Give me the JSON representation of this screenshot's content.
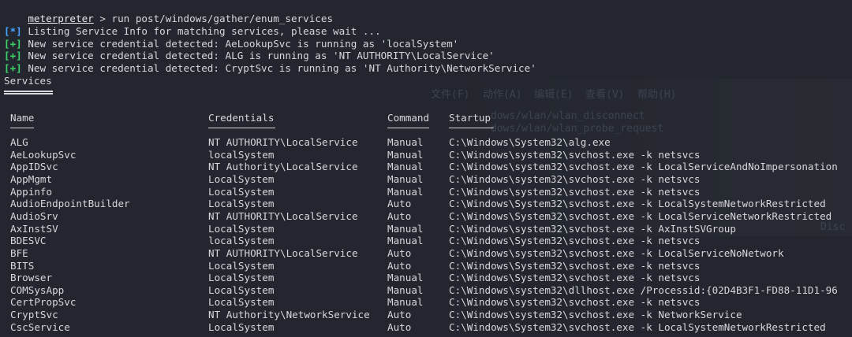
{
  "prompt": {
    "name": "meterpreter",
    "command": " > run post/windows/gather/enum_services"
  },
  "messages": [
    {
      "tag": "[*]",
      "kind": "info",
      "text": " Listing Service Info for matching services, please wait ..."
    },
    {
      "tag": "[+]",
      "kind": "good",
      "text": " New service credential detected: AeLookupSvc is running as 'localSystem'"
    },
    {
      "tag": "[+]",
      "kind": "good",
      "text": " New service credential detected: ALG is running as 'NT AUTHORITY\\LocalService'"
    },
    {
      "tag": "[+]",
      "kind": "good",
      "text": " New service credential detected: CryptSvc is running as 'NT Authority\\NetworkService'"
    }
  ],
  "section_title": "Services",
  "table": {
    "headers": [
      "Name",
      "Credentials",
      "Command",
      "Startup"
    ],
    "rows": [
      [
        "ALG",
        "NT AUTHORITY\\LocalService",
        "Manual",
        "C:\\Windows\\System32\\alg.exe"
      ],
      [
        "AeLookupSvc",
        "localSystem",
        "Manual",
        "C:\\Windows\\system32\\svchost.exe -k netsvcs"
      ],
      [
        "AppIDSvc",
        "NT Authority\\LocalService",
        "Manual",
        "C:\\Windows\\system32\\svchost.exe -k LocalServiceAndNoImpersonation"
      ],
      [
        "AppMgmt",
        "LocalSystem",
        "Manual",
        "C:\\Windows\\system32\\svchost.exe -k netsvcs"
      ],
      [
        "Appinfo",
        "LocalSystem",
        "Manual",
        "C:\\Windows\\system32\\svchost.exe -k netsvcs"
      ],
      [
        "AudioEndpointBuilder",
        "LocalSystem",
        "Auto",
        "C:\\Windows\\System32\\svchost.exe -k LocalSystemNetworkRestricted"
      ],
      [
        "AudioSrv",
        "NT AUTHORITY\\LocalService",
        "Auto",
        "C:\\Windows\\System32\\svchost.exe -k LocalServiceNetworkRestricted"
      ],
      [
        "AxInstSV",
        "LocalSystem",
        "Manual",
        "C:\\Windows\\system32\\svchost.exe -k AxInstSVGroup"
      ],
      [
        "BDESVC",
        "localSystem",
        "Manual",
        "C:\\Windows\\System32\\svchost.exe -k netsvcs"
      ],
      [
        "BFE",
        "NT AUTHORITY\\LocalService",
        "Auto",
        "C:\\Windows\\system32\\svchost.exe -k LocalServiceNoNetwork"
      ],
      [
        "BITS",
        "LocalSystem",
        "Auto",
        "C:\\Windows\\System32\\svchost.exe -k netsvcs"
      ],
      [
        "Browser",
        "LocalSystem",
        "Manual",
        "C:\\Windows\\System32\\svchost.exe -k netsvcs"
      ],
      [
        "COMSysApp",
        "LocalSystem",
        "Manual",
        "C:\\Windows\\system32\\dllhost.exe /Processid:{02D4B3F1-FD88-11D1-96"
      ],
      [
        "CertPropSvc",
        "LocalSystem",
        "Manual",
        "C:\\Windows\\system32\\svchost.exe -k netsvcs"
      ],
      [
        "CryptSvc",
        "NT Authority\\NetworkService",
        "Auto",
        "C:\\Windows\\system32\\svchost.exe -k NetworkService"
      ],
      [
        "CscService",
        "LocalSystem",
        "Auto",
        "C:\\Windows\\System32\\svchost.exe -k LocalSystemNetworkRestricted"
      ]
    ]
  },
  "background_ghost": {
    "menu": [
      "文件(F)",
      "动作(A)",
      "编辑(E)",
      "查看(V)",
      "帮助(H)"
    ],
    "lines": [
      "dows/wlan/wlan_disconnect",
      "dows/wlan/wlan_probe_request",
      "Disc"
    ]
  },
  "colors": {
    "background": "#23262e",
    "text": "#d6d8dc",
    "info": "#4aa3ff",
    "good": "#3ed46a"
  }
}
